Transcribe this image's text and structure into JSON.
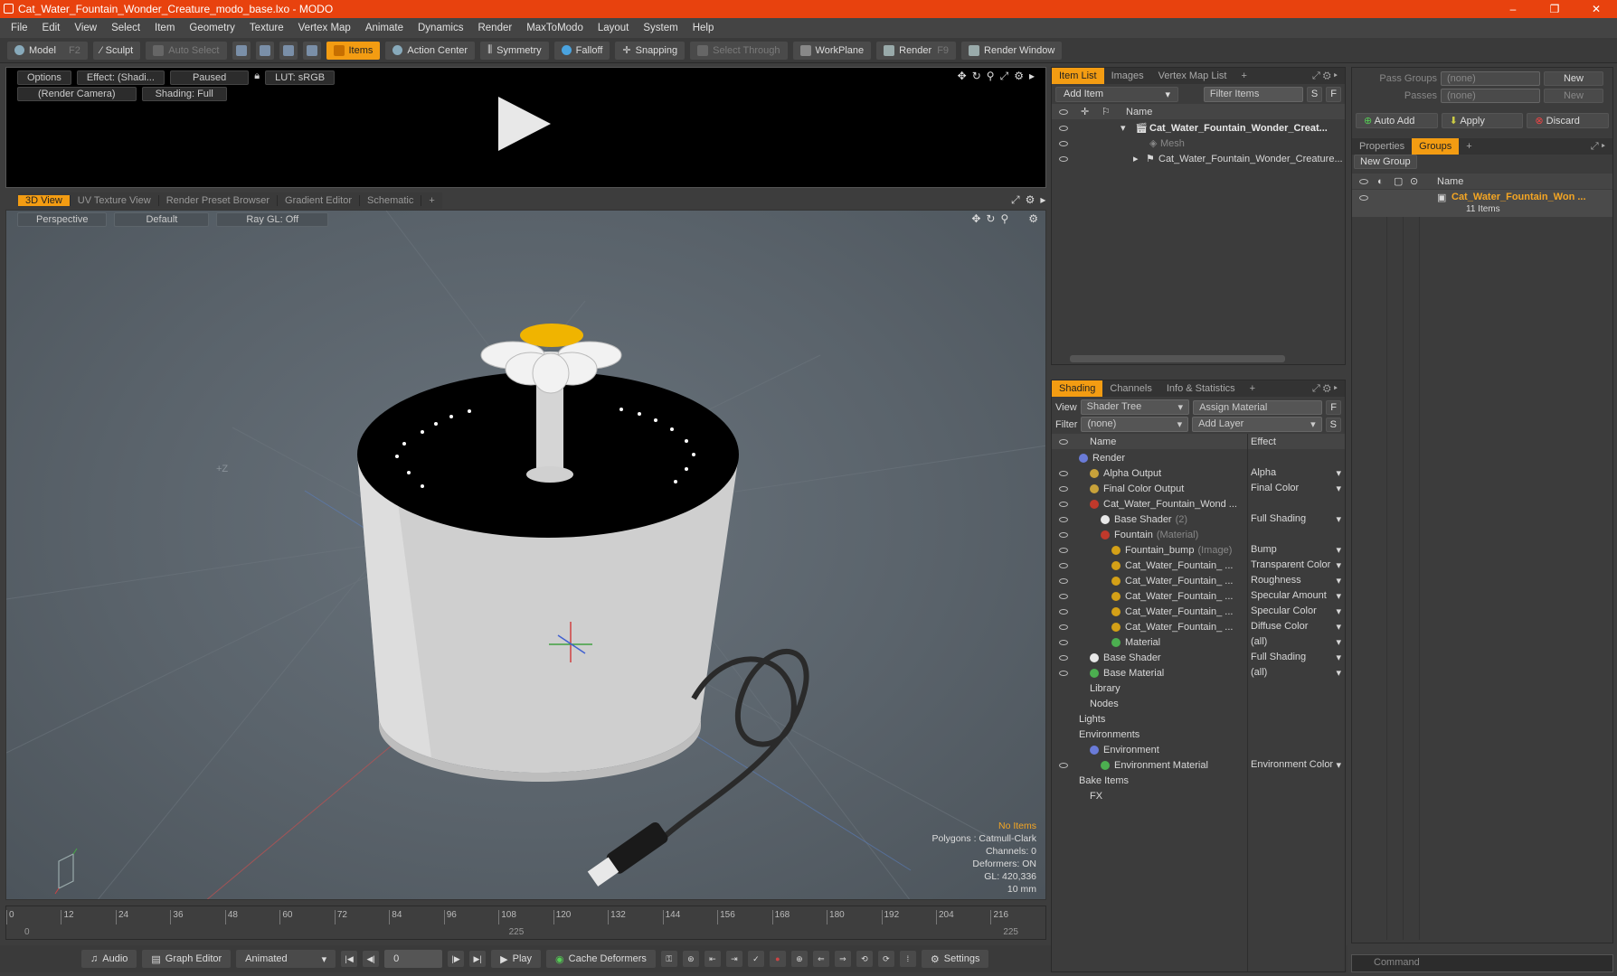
{
  "window": {
    "title": "Cat_Water_Fountain_Wonder_Creature_modo_base.lxo - MODO",
    "controls": [
      "–",
      "❐",
      "✕"
    ]
  },
  "menu": [
    "File",
    "Edit",
    "View",
    "Select",
    "Item",
    "Geometry",
    "Texture",
    "Vertex Map",
    "Animate",
    "Dynamics",
    "Render",
    "MaxToModo",
    "Layout",
    "System",
    "Help"
  ],
  "toolbar": {
    "model": "Model",
    "model_key": "F2",
    "sculpt": "Sculpt",
    "auto_select": "Auto Select",
    "items": "Items",
    "action_center": "Action Center",
    "symmetry": "Symmetry",
    "falloff": "Falloff",
    "snapping": "Snapping",
    "select_through": "Select Through",
    "workplane": "WorkPlane",
    "render": "Render",
    "render_key": "F9",
    "render_window": "Render Window"
  },
  "preview": {
    "options": "Options",
    "effect": "Effect: (Shadi...",
    "paused": "Paused",
    "lut": "LUT: sRGB",
    "camera": "(Render Camera)",
    "shading": "Shading: Full"
  },
  "viewport_tabs": [
    "3D View",
    "UV Texture View",
    "Render Preset Browser",
    "Gradient Editor",
    "Schematic",
    "+"
  ],
  "viewport": {
    "perspective": "Perspective",
    "default": "Default",
    "raygl": "Ray GL: Off",
    "axis_z": "+Z",
    "stats": {
      "items": "No Items",
      "polygons": "Polygons : Catmull-Clark",
      "channels": "Channels: 0",
      "deformers": "Deformers: ON",
      "gl": "GL: 420,336",
      "size": "10 mm"
    }
  },
  "timeline": {
    "ticks": [
      "0",
      "12",
      "24",
      "36",
      "48",
      "60",
      "72",
      "84",
      "96",
      "108",
      "120",
      "132",
      "144",
      "156",
      "168",
      "180",
      "192",
      "204",
      "216"
    ],
    "start": "0",
    "mid": "225",
    "end": "225"
  },
  "bottombar": {
    "audio": "Audio",
    "graph_editor": "Graph Editor",
    "animated": "Animated",
    "frame": "0",
    "play": "Play",
    "cache": "Cache Deformers",
    "settings": "Settings"
  },
  "itemlist": {
    "tabs": [
      "Item List",
      "Images",
      "Vertex Map List",
      "+"
    ],
    "add_item": "Add Item",
    "filter": "Filter Items",
    "s": "S",
    "f": "F",
    "col_name": "Name",
    "rows": [
      {
        "label": "Cat_Water_Fountain_Wonder_Creat...",
        "type": "scene"
      },
      {
        "label": "Mesh",
        "type": "mesh"
      },
      {
        "label": "Cat_Water_Fountain_Wonder_Creature...",
        "type": "group"
      }
    ]
  },
  "shading": {
    "tabs": [
      "Shading",
      "Channels",
      "Info & Statistics",
      "+"
    ],
    "view_label": "View",
    "view_value": "Shader Tree",
    "assign": "Assign Material",
    "f": "F",
    "filter_label": "Filter",
    "filter_value": "(none)",
    "add_layer": "Add Layer",
    "s": "S",
    "col_name": "Name",
    "col_effect": "Effect",
    "rows": [
      {
        "name": "Render",
        "effect": "",
        "indent": 0,
        "color": "#6a7bd8",
        "eye": false
      },
      {
        "name": "Alpha Output",
        "effect": "Alpha",
        "indent": 1,
        "color": "#c8a23a",
        "eye": true
      },
      {
        "name": "Final Color Output",
        "effect": "Final Color",
        "indent": 1,
        "color": "#c8a23a",
        "eye": true
      },
      {
        "name": "Cat_Water_Fountain_Wond ...",
        "effect": "",
        "indent": 1,
        "color": "#c0392b",
        "eye": true
      },
      {
        "name": "Base Shader",
        "sub": "(2)",
        "effect": "Full Shading",
        "indent": 2,
        "color": "#e8e8e8",
        "eye": true
      },
      {
        "name": "Fountain",
        "sub": "(Material)",
        "effect": "",
        "indent": 2,
        "color": "#c0392b",
        "eye": true
      },
      {
        "name": "Fountain_bump",
        "sub": "(Image)",
        "effect": "Bump",
        "indent": 3,
        "color": "#d4a017",
        "eye": true
      },
      {
        "name": "Cat_Water_Fountain_ ...",
        "effect": "Transparent Color",
        "indent": 3,
        "color": "#d4a017",
        "eye": true
      },
      {
        "name": "Cat_Water_Fountain_ ...",
        "effect": "Roughness",
        "indent": 3,
        "color": "#d4a017",
        "eye": true
      },
      {
        "name": "Cat_Water_Fountain_ ...",
        "effect": "Specular Amount",
        "indent": 3,
        "color": "#d4a017",
        "eye": true
      },
      {
        "name": "Cat_Water_Fountain_ ...",
        "effect": "Specular Color",
        "indent": 3,
        "color": "#d4a017",
        "eye": true
      },
      {
        "name": "Cat_Water_Fountain_ ...",
        "effect": "Diffuse Color",
        "indent": 3,
        "color": "#d4a017",
        "eye": true
      },
      {
        "name": "Material",
        "effect": "(all)",
        "indent": 3,
        "color": "#4caf50",
        "eye": true
      },
      {
        "name": "Base Shader",
        "effect": "Full Shading",
        "indent": 1,
        "color": "#e8e8e8",
        "eye": true
      },
      {
        "name": "Base Material",
        "effect": "(all)",
        "indent": 1,
        "color": "#4caf50",
        "eye": true
      },
      {
        "name": "Library",
        "effect": "",
        "indent": 1,
        "color": "",
        "eye": false
      },
      {
        "name": "Nodes",
        "effect": "",
        "indent": 1,
        "color": "",
        "eye": false
      },
      {
        "name": "Lights",
        "effect": "",
        "indent": 0,
        "color": "",
        "eye": false
      },
      {
        "name": "Environments",
        "effect": "",
        "indent": 0,
        "color": "",
        "eye": false
      },
      {
        "name": "Environment",
        "effect": "",
        "indent": 1,
        "color": "#6a7bd8",
        "eye": false
      },
      {
        "name": "Environment Material",
        "effect": "Environment Color",
        "indent": 2,
        "color": "#4caf50",
        "eye": true
      },
      {
        "name": "Bake Items",
        "effect": "",
        "indent": 0,
        "color": "",
        "eye": false
      },
      {
        "name": "FX",
        "effect": "",
        "indent": 1,
        "color": "",
        "eye": false
      }
    ]
  },
  "groups": {
    "pass_groups": "Pass Groups",
    "passes": "Passes",
    "none1": "(none)",
    "none2": "(none)",
    "new1": "New",
    "new2": "New",
    "auto_add": "Auto Add",
    "apply": "Apply",
    "discard": "Discard",
    "tabs": [
      "Properties",
      "Groups",
      "+"
    ],
    "new_group": "New Group",
    "col_name": "Name",
    "item_name": "Cat_Water_Fountain_Won ...",
    "item_count": "11 Items"
  },
  "command": {
    "placeholder": "Command"
  }
}
